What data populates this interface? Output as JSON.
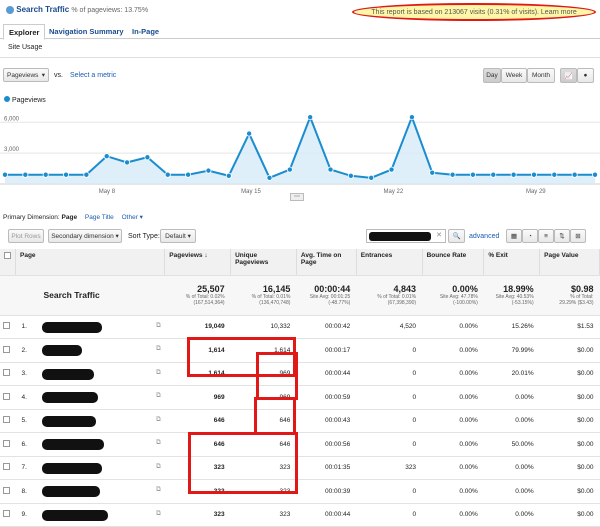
{
  "header": {
    "title": "Search Traffic",
    "subtitle": "% of pageviews: 13.75%",
    "sampling": "This report is based on 213067 visits (0.31% of visits). Learn more"
  },
  "tabs": [
    "Explorer",
    "Navigation Summary",
    "In-Page"
  ],
  "subtab": "Site Usage",
  "controls": {
    "metric": "Pageviews",
    "vs": "vs.",
    "select_metric": "Select a metric",
    "day": "Day",
    "week": "Week",
    "month": "Month"
  },
  "chart_data": {
    "type": "line",
    "series": [
      {
        "name": "Pageviews",
        "values": [
          900,
          900,
          900,
          900,
          900,
          2700,
          2100,
          2600,
          900,
          900,
          1300,
          800,
          4900,
          600,
          1400,
          6500,
          1400,
          800,
          600,
          1400,
          6500,
          1100,
          900,
          900,
          900,
          900,
          900,
          900,
          900,
          900
        ]
      }
    ],
    "ylim": [
      0,
      6000
    ],
    "yticks": [
      "6,000",
      "3,000"
    ],
    "xticks": [
      "May 8",
      "May 15",
      "May 22",
      "May 29"
    ],
    "color": "#1a8cd0"
  },
  "dimension": {
    "label": "Primary Dimension:",
    "page": "Page",
    "page_title": "Page Title",
    "other": "Other ▾",
    "plot_rows": "Plot Rows",
    "secondary": "Secondary dimension",
    "sort_type": "Sort Type:",
    "default": "Default",
    "advanced": "advanced"
  },
  "table": {
    "headers": [
      "Page",
      "Pageviews",
      "Unique Pageviews",
      "Avg. Time on Page",
      "Entrances",
      "Bounce Rate",
      "% Exit",
      "Page Value"
    ],
    "totals": {
      "label": "Search Traffic",
      "values": [
        "25,507",
        "16,145",
        "00:00:44",
        "4,843",
        "0.00%",
        "18.99%",
        "$0.98"
      ],
      "sub1": [
        "% of Total: 0.02%",
        "% of Total: 0.01%",
        "Site Avg: 00:01:25",
        "% of Total: 0.01%",
        "Site Avg: 47.78%",
        "Site Avg: 40.53%",
        "% of Total:"
      ],
      "sub2": [
        "(167,514,364)",
        "(136,470,748)",
        "(-48.77%)",
        "(67,398,390)",
        "(-100.00%)",
        "(-53.15%)",
        "29.29% ($3.43)"
      ]
    },
    "rows": [
      [
        "1.",
        "19,049",
        "10,332",
        "00:00:42",
        "4,520",
        "0.00%",
        "15.26%",
        "$1.53"
      ],
      [
        "2.",
        "1,614",
        "1,614",
        "00:00:17",
        "0",
        "0.00%",
        "79.99%",
        "$0.00"
      ],
      [
        "3.",
        "1,614",
        "969",
        "00:00:44",
        "0",
        "0.00%",
        "20.01%",
        "$0.00"
      ],
      [
        "4.",
        "969",
        "969",
        "00:00:59",
        "0",
        "0.00%",
        "0.00%",
        "$0.00"
      ],
      [
        "5.",
        "646",
        "646",
        "00:00:43",
        "0",
        "0.00%",
        "0.00%",
        "$0.00"
      ],
      [
        "6.",
        "646",
        "646",
        "00:00:56",
        "0",
        "0.00%",
        "50.00%",
        "$0.00"
      ],
      [
        "7.",
        "323",
        "323",
        "00:01:35",
        "323",
        "0.00%",
        "0.00%",
        "$0.00"
      ],
      [
        "8.",
        "323",
        "323",
        "00:00:39",
        "0",
        "0.00%",
        "0.00%",
        "$0.00"
      ],
      [
        "9.",
        "323",
        "323",
        "00:00:44",
        "0",
        "0.00%",
        "0.00%",
        "$0.00"
      ]
    ]
  }
}
